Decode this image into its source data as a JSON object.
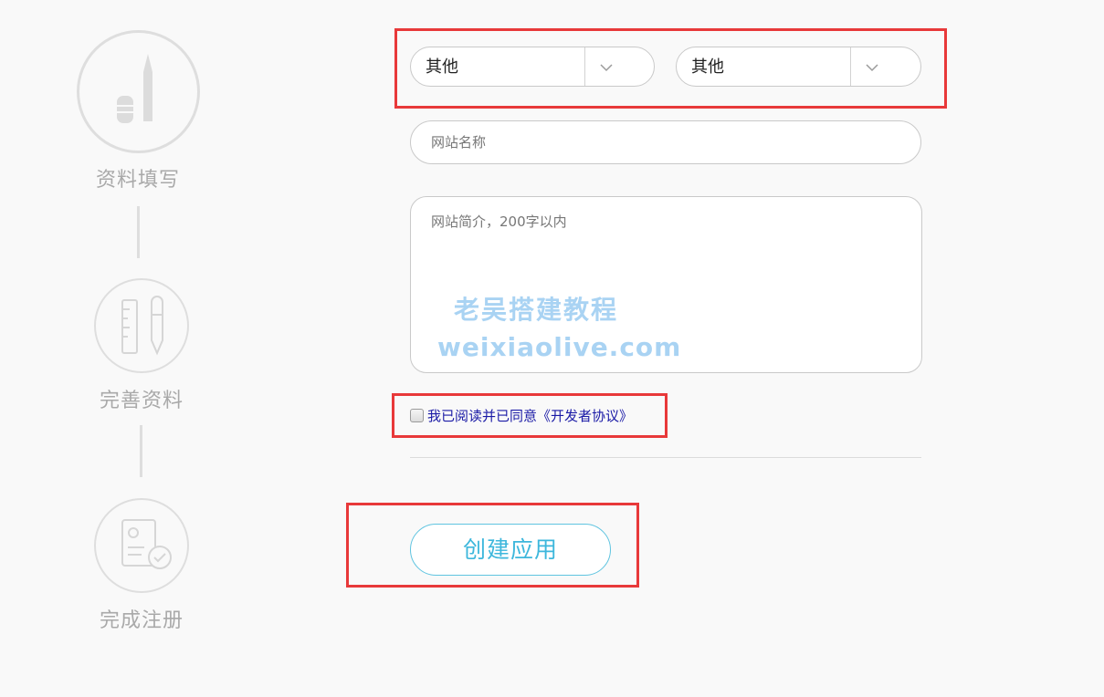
{
  "steps": [
    {
      "label": "资料填写"
    },
    {
      "label": "完善资料"
    },
    {
      "label": "完成注册"
    }
  ],
  "form": {
    "select_1": {
      "value": "其他"
    },
    "select_2": {
      "value": "其他"
    },
    "site_name": {
      "placeholder": "网站名称"
    },
    "site_desc": {
      "placeholder": "网站简介，200字以内"
    },
    "agreement": {
      "prefix": "我已阅读并已同意",
      "link": "《开发者协议》",
      "checked": false
    },
    "submit_label": "创建应用"
  },
  "watermark": {
    "title": "老吴搭建教程",
    "url": "weixiaolive.com"
  },
  "colors": {
    "annotation_red": "#e8393a",
    "button_accent": "#3db7dc",
    "link_blue": "#1a1aa6"
  },
  "icons": [
    "pen-icon",
    "ruler-pencil-icon",
    "document-check-icon",
    "chevron-down-icon"
  ]
}
